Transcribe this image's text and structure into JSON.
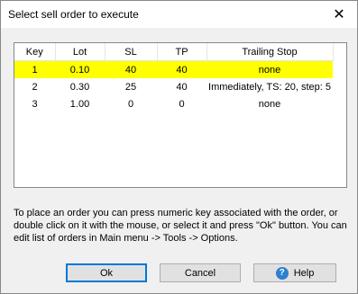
{
  "window": {
    "title": "Select sell order to execute",
    "close_glyph": "✕"
  },
  "orders_table": {
    "columns": [
      "Key",
      "Lot",
      "SL",
      "TP",
      "Trailing Stop"
    ],
    "rows": [
      {
        "key": "1",
        "lot": "0.10",
        "sl": "40",
        "tp": "40",
        "trailing_stop": "none",
        "selected": true
      },
      {
        "key": "2",
        "lot": "0.30",
        "sl": "25",
        "tp": "40",
        "trailing_stop": "Immediately, TS: 20, step: 5",
        "selected": false
      },
      {
        "key": "3",
        "lot": "1.00",
        "sl": "0",
        "tp": "0",
        "trailing_stop": "none",
        "selected": false
      }
    ]
  },
  "hint": {
    "line1": "To place an order you can press numeric key associated with the order,  or",
    "line2": "double click on it with the mouse, or select it and press \"Ok\" button. You can",
    "line3": "edit list of orders in Main menu -> Tools -> Options."
  },
  "buttons": {
    "ok_label": "Ok",
    "cancel_label": "Cancel",
    "help_label": "Help",
    "help_icon_glyph": "?"
  },
  "colors": {
    "selected_row": "#ffff00",
    "default_button_border": "#0078d7"
  }
}
